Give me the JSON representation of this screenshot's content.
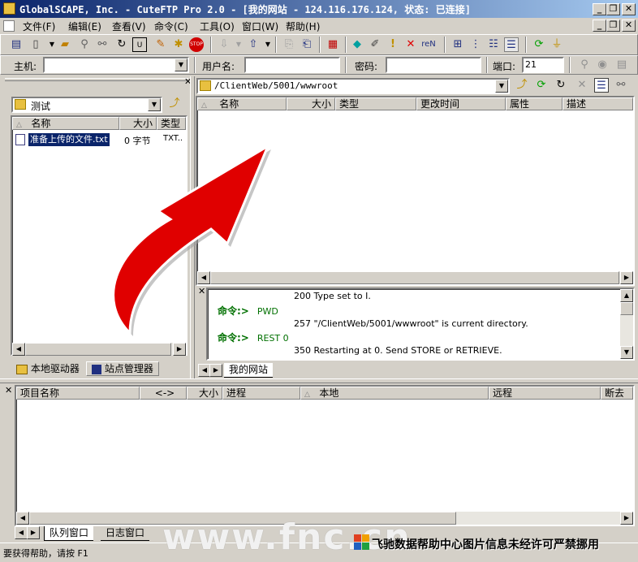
{
  "window": {
    "title": "GlobalSCAPE, Inc. - CuteFTP Pro 2.0 - [我的网站 - 124.116.176.124, 状态: 已连接]",
    "minimize": "_",
    "restore": "❐",
    "close": "✕",
    "inner_minimize": "_",
    "inner_restore": "❐",
    "inner_close": "✕"
  },
  "menu": [
    "文件(F)",
    "编辑(E)",
    "查看(V)",
    "命令(C)",
    "工具(O)",
    "窗口(W)",
    "帮助(H)"
  ],
  "quickconnect": {
    "host_label": "主机:",
    "host_value": "",
    "user_label": "用户名:",
    "user_value": "",
    "password_label": "密码:",
    "password_value": "",
    "port_label": "端口:",
    "port_value": "21"
  },
  "local_pane": {
    "folder": "测试",
    "columns": [
      "名称",
      "大小",
      "类型"
    ],
    "files": [
      {
        "name": "准备上传的文件.txt",
        "size": "0 字节",
        "type": "TXT.."
      }
    ],
    "tabs": [
      "本地驱动器",
      "站点管理器"
    ]
  },
  "remote_pane": {
    "path": "/ClientWeb/5001/wwwroot",
    "columns": [
      "名称",
      "大小",
      "类型",
      "更改时间",
      "属性",
      "描述"
    ],
    "files": []
  },
  "log": {
    "lines": [
      {
        "kind": "response",
        "text": "200 Type set to I."
      },
      {
        "kind": "command",
        "label": "命令:>",
        "text": "PWD"
      },
      {
        "kind": "response",
        "text": "257 \"/ClientWeb/5001/wwwroot\" is current directory."
      },
      {
        "kind": "command",
        "label": "命令:>",
        "text": "REST 0"
      },
      {
        "kind": "response",
        "text": "350 Restarting at 0. Send STORE or RETRIEVE."
      }
    ],
    "site_tab": "我的网站"
  },
  "queue": {
    "columns": [
      "项目名称",
      "<->",
      "大小",
      "进程",
      "本地",
      "远程",
      "断去"
    ],
    "tabs": [
      "队列窗口",
      "日志窗口"
    ]
  },
  "status_bar": {
    "text": "要获得帮助，请按 F1"
  },
  "watermark": {
    "site": "www.fnc.cn",
    "notice": "飞驰数据帮助中心图片信息未经许可严禁挪用"
  },
  "colors": {
    "title_start": "#0a246a",
    "title_end": "#a6caf0",
    "face": "#d4d0c8",
    "selection": "#0a246a",
    "arrow": "#e00000",
    "log_command": "#007000"
  }
}
